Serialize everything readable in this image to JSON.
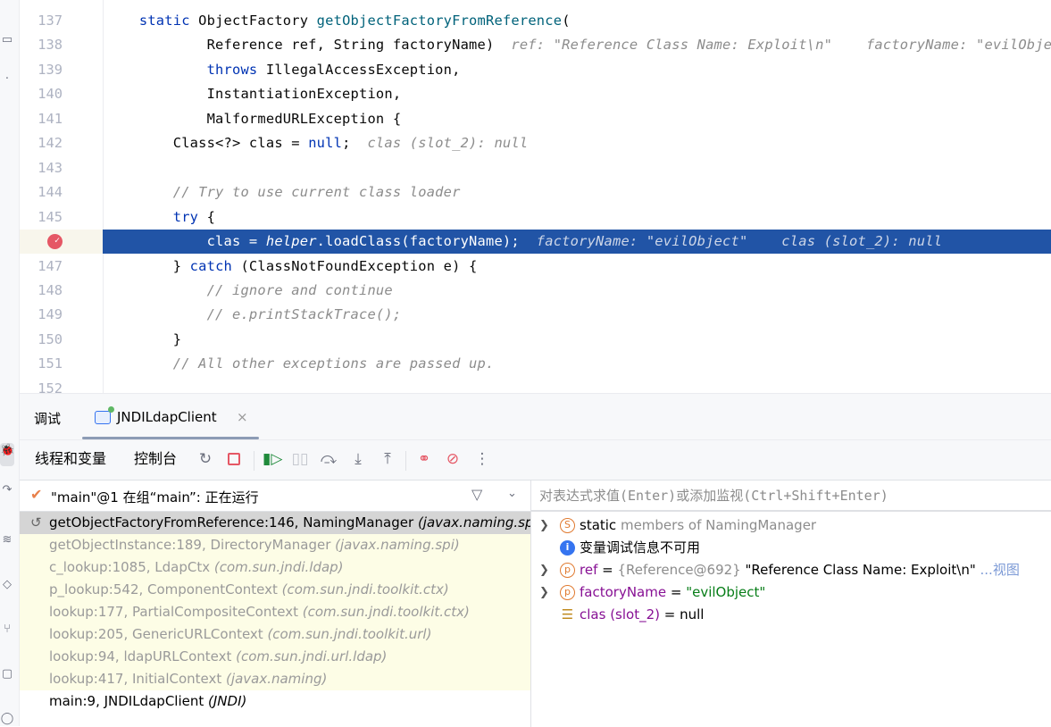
{
  "editor": {
    "current_line": 146,
    "lines": [
      {
        "n": "137",
        "tokens": [
          {
            "t": "    "
          },
          {
            "t": "static ",
            "c": "kw"
          },
          {
            "t": "ObjectFactory ",
            "c": "tx"
          },
          {
            "t": "getObjectFactoryFromReference",
            "c": "fn"
          },
          {
            "t": "(",
            "c": "tx"
          }
        ]
      },
      {
        "n": "138",
        "tokens": [
          {
            "t": "            Reference ref, String factoryName)  ",
            "c": "tx"
          },
          {
            "t": "ref: \"Reference Class Name: Exploit\\n\"    factoryName: \"evilObject\"",
            "c": "hint"
          }
        ]
      },
      {
        "n": "139",
        "tokens": [
          {
            "t": "            "
          },
          {
            "t": "throws ",
            "c": "kw"
          },
          {
            "t": "IllegalAccessException,",
            "c": "tx"
          }
        ]
      },
      {
        "n": "140",
        "tokens": [
          {
            "t": "            InstantiationException,",
            "c": "tx"
          }
        ]
      },
      {
        "n": "141",
        "tokens": [
          {
            "t": "            MalformedURLException {",
            "c": "tx"
          }
        ]
      },
      {
        "n": "142",
        "tokens": [
          {
            "t": "        Class<?> clas = ",
            "c": "tx"
          },
          {
            "t": "null",
            "c": "kw"
          },
          {
            "t": ";  ",
            "c": "tx"
          },
          {
            "t": "clas (slot_2): null",
            "c": "hint"
          }
        ]
      },
      {
        "n": "143",
        "tokens": []
      },
      {
        "n": "144",
        "tokens": [
          {
            "t": "        "
          },
          {
            "t": "// Try to use current class loader",
            "c": "cm"
          }
        ]
      },
      {
        "n": "145",
        "tokens": [
          {
            "t": "        "
          },
          {
            "t": "try ",
            "c": "kw"
          },
          {
            "t": "{",
            "c": "tx"
          }
        ]
      },
      {
        "n": "146",
        "tokens": [
          {
            "t": "            clas = ",
            "c": "tx"
          },
          {
            "t": "helper",
            "c": "it"
          },
          {
            "t": ".loadClass(factoryName);  ",
            "c": "tx"
          },
          {
            "t": "factoryName: \"evilObject\"    clas (slot_2): null",
            "c": "hint"
          }
        ]
      },
      {
        "n": "147",
        "tokens": [
          {
            "t": "        } ",
            "c": "tx"
          },
          {
            "t": "catch ",
            "c": "kw"
          },
          {
            "t": "(ClassNotFoundException e) {",
            "c": "tx"
          }
        ]
      },
      {
        "n": "148",
        "tokens": [
          {
            "t": "            "
          },
          {
            "t": "// ignore and continue",
            "c": "cm"
          }
        ]
      },
      {
        "n": "149",
        "tokens": [
          {
            "t": "            "
          },
          {
            "t": "// e.printStackTrace();",
            "c": "cm"
          }
        ]
      },
      {
        "n": "150",
        "tokens": [
          {
            "t": "        }",
            "c": "tx"
          }
        ]
      },
      {
        "n": "151",
        "tokens": [
          {
            "t": "        "
          },
          {
            "t": "// All other exceptions are passed up.",
            "c": "cm"
          }
        ]
      },
      {
        "n": "152",
        "tokens": []
      }
    ]
  },
  "debug": {
    "tab_debug": "调试",
    "tab_session": "JNDILdapClient",
    "toolbar": {
      "threads_vars": "线程和变量",
      "console": "控制台",
      "icons": [
        "rerun-icon",
        "stop-icon",
        "resume-icon",
        "pause-icon",
        "step-over-icon",
        "step-into-icon",
        "step-out-icon",
        "view-breakpoints-icon",
        "mute-breakpoints-icon",
        "more-icon"
      ]
    },
    "thread": "\"main\"@1 在组“main”: 正在运行",
    "frames": [
      {
        "m": "getObjectFactoryFromReference:146, NamingManager ",
        "p": "(javax.naming.spi)",
        "k": "sel"
      },
      {
        "m": "getObjectInstance:189, DirectoryManager ",
        "p": "(javax.naming.spi)",
        "k": "lib"
      },
      {
        "m": "c_lookup:1085, LdapCtx ",
        "p": "(com.sun.jndi.ldap)",
        "k": "lib"
      },
      {
        "m": "p_lookup:542, ComponentContext ",
        "p": "(com.sun.jndi.toolkit.ctx)",
        "k": "lib"
      },
      {
        "m": "lookup:177, PartialCompositeContext ",
        "p": "(com.sun.jndi.toolkit.ctx)",
        "k": "lib"
      },
      {
        "m": "lookup:205, GenericURLContext ",
        "p": "(com.sun.jndi.toolkit.url)",
        "k": "lib"
      },
      {
        "m": "lookup:94, ldapURLContext ",
        "p": "(com.sun.jndi.url.ldap)",
        "k": "lib"
      },
      {
        "m": "lookup:417, InitialContext ",
        "p": "(javax.naming)",
        "k": "lib"
      },
      {
        "m": "main:9, JNDILdapClient ",
        "p": "(JNDI)",
        "k": "user"
      }
    ],
    "eval_placeholder": "对表达式求值(Enter)或添加监视(Ctrl+Shift+Enter)",
    "vars": {
      "static_kw": "static",
      "static_rest": " members of NamingManager",
      "info": "变量调试信息不可用",
      "ref_name": "ref",
      "ref_eq": " = ",
      "ref_type": "{Reference@692}",
      "ref_val": " \"Reference Class Name: Exploit\\n\" ",
      "ref_link": "...视图",
      "fn_name": "factoryName",
      "fn_eq": " = ",
      "fn_val": "\"evilObject\"",
      "clas_name": "clas (slot_2)",
      "clas_val": " = null"
    }
  }
}
